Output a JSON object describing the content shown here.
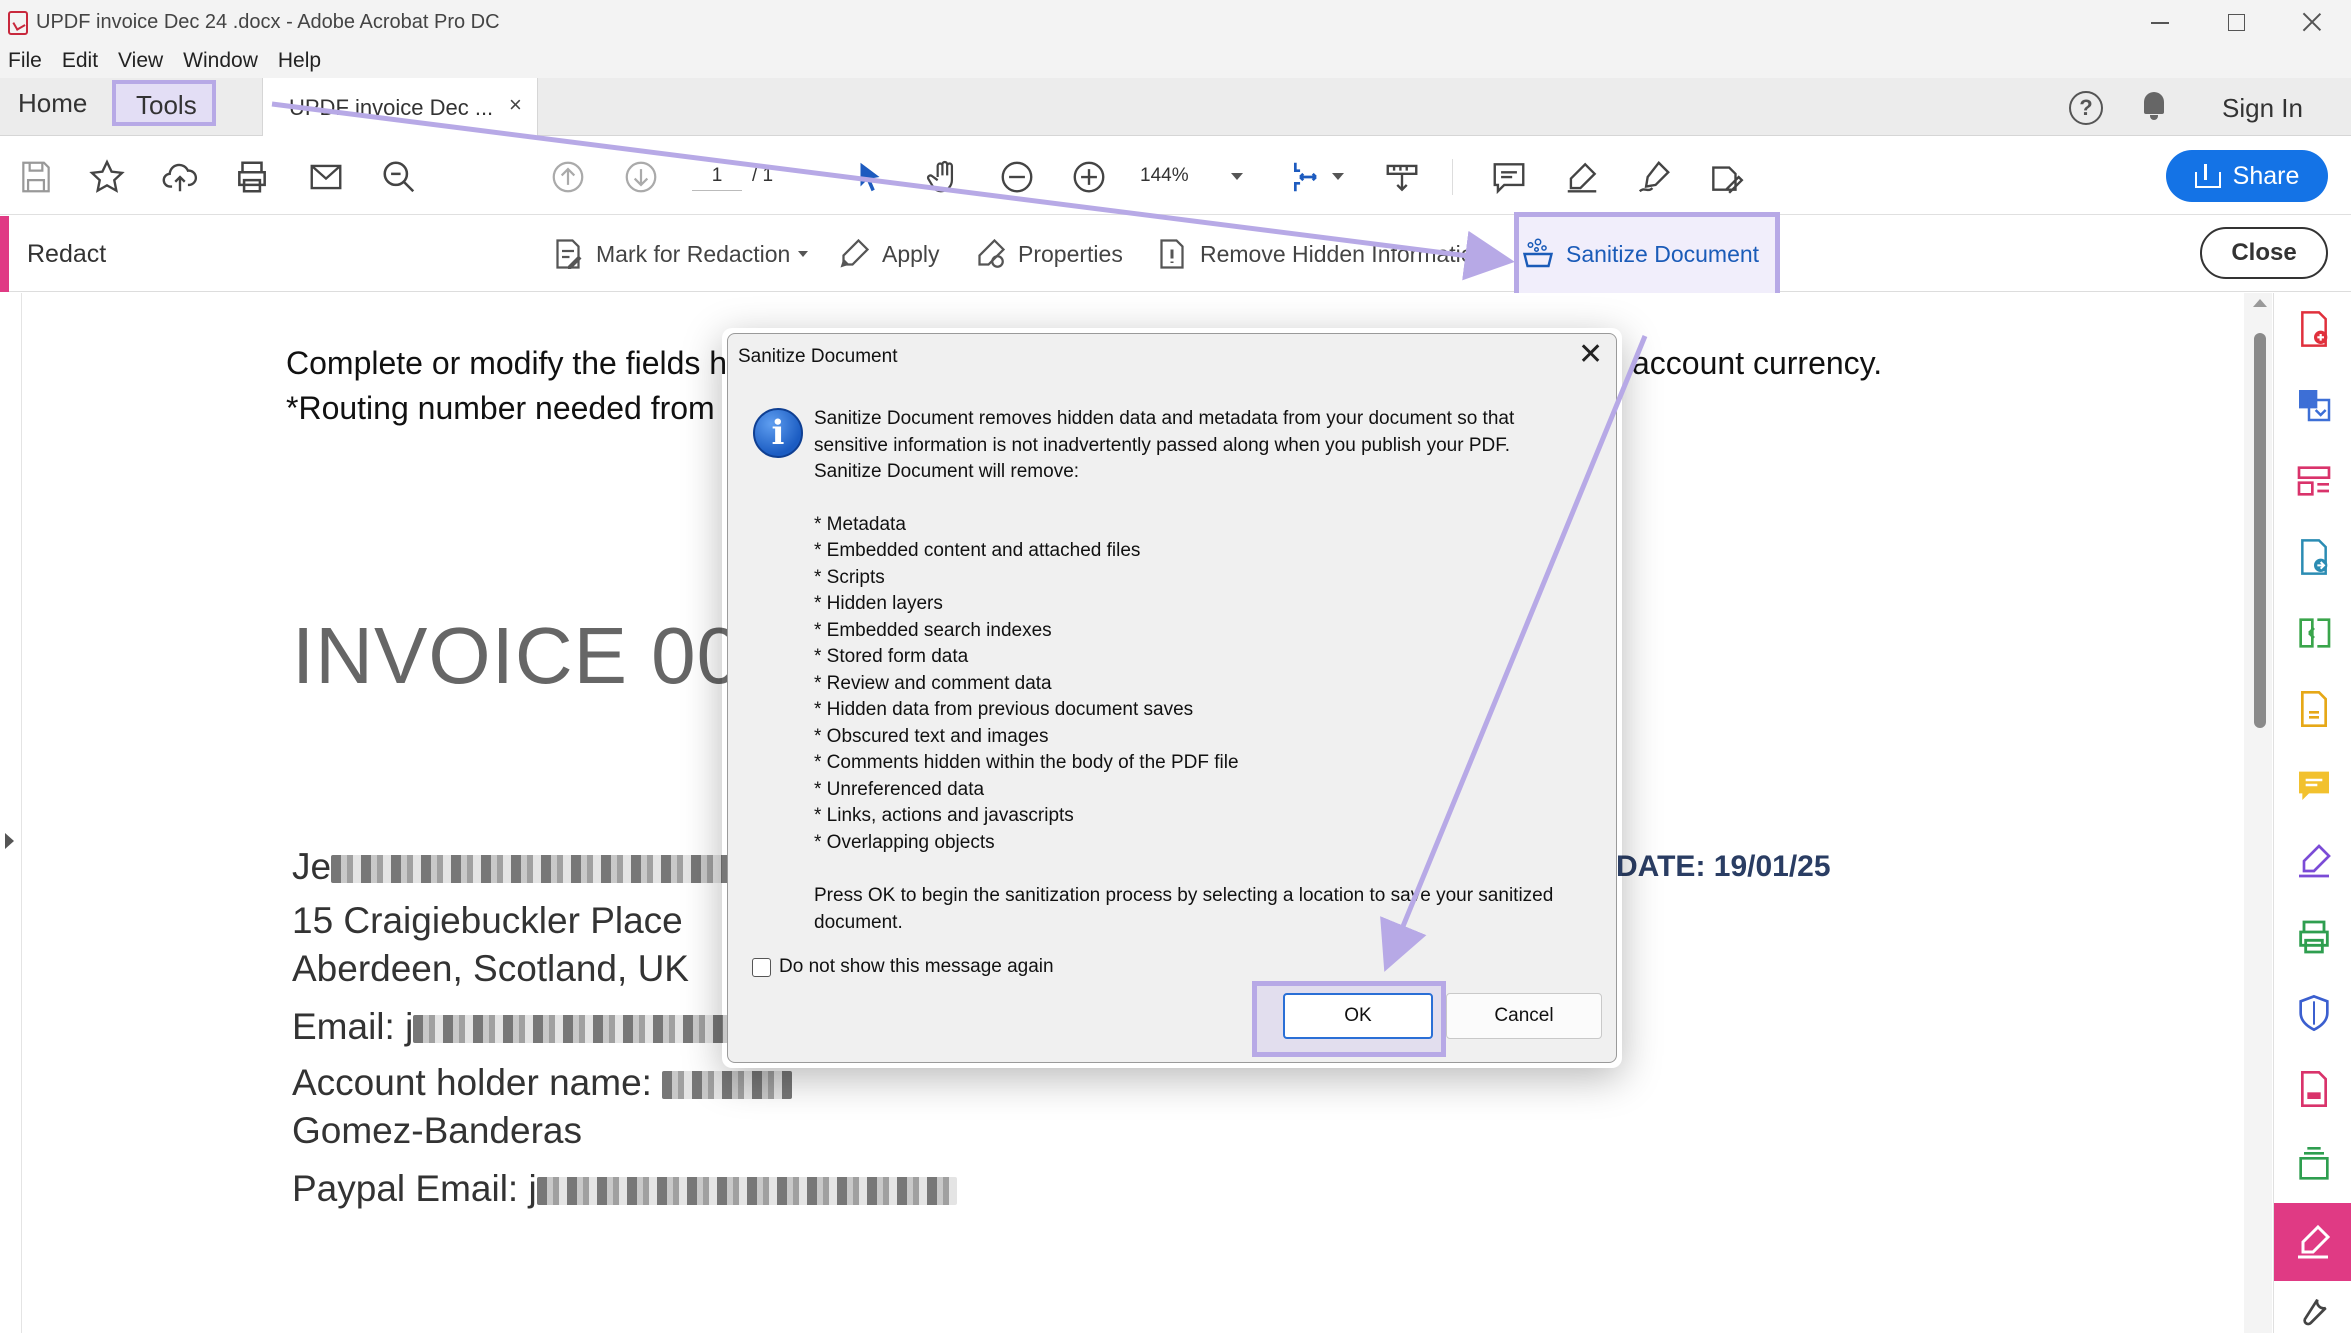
{
  "window": {
    "title": "UPDF invoice Dec 24 .docx - Adobe Acrobat Pro DC"
  },
  "menu": {
    "items": [
      "File",
      "Edit",
      "Window",
      "View",
      "Help"
    ]
  },
  "menu_order": [
    "File",
    "Edit",
    "View",
    "Window",
    "Help"
  ],
  "tabs": {
    "home": "Home",
    "tools": "Tools",
    "document": "UPDF invoice Dec ...",
    "document_close": "×"
  },
  "header_right": {
    "help": "?",
    "sign_in": "Sign In"
  },
  "toolbar": {
    "page_current": "1",
    "page_total": "/ 1",
    "zoom": "144%",
    "share_label": "Share"
  },
  "redact_bar": {
    "title": "Redact",
    "items": {
      "mark": "Mark for Redaction",
      "apply": "Apply",
      "properties": "Properties",
      "remove_hidden": "Remove Hidden Information",
      "sanitize": "Sanitize Document"
    },
    "close_label": "Close"
  },
  "document": {
    "line1_start": "Complete or modify the fields h",
    "line1_end": "account currency.",
    "line2_start": "*Routing number needed from",
    "invoice_title": "INVOICE 000",
    "name_visible": "Je",
    "address_line1": "15 Craigiebuckler Place",
    "address_line2": "Aberdeen, Scotland, UK",
    "email_label": "Email: j",
    "account_holder_label": "Account holder name:",
    "account_holder_rest": "Gomez-Banderas",
    "paypal_label": "Paypal Email: j",
    "date": "DATE: 19/01/25"
  },
  "dialog": {
    "title": "Sanitize Document",
    "close": "✕",
    "intro": "Sanitize Document removes hidden data and metadata from your document so that\nsensitive information is not inadvertently passed along when you publish your PDF.\nSanitize Document will remove:",
    "remove_items": [
      "* Metadata",
      "* Embedded content and attached files",
      "* Scripts",
      "* Hidden layers",
      "* Embedded search indexes",
      "* Stored form data",
      "* Review and comment data",
      "* Hidden data from previous document saves",
      "* Obscured text and images",
      "* Comments hidden within the body of the PDF file",
      "* Unreferenced data",
      "* Links, actions and javascripts",
      "* Overlapping objects"
    ],
    "footer": "Press OK to begin the sanitization process by selecting a location to save your sanitized\ndocument.",
    "checkbox_label": "Do not show this message again",
    "ok_label": "OK",
    "cancel_label": "Cancel"
  },
  "colors": {
    "accent_purple_highlight": "#b7a9e6",
    "share_blue": "#1473e6",
    "redact_pink": "#e03a84",
    "sanitize_text_blue": "#1a5bb8",
    "date_navy": "#2a3d63"
  },
  "icons": {
    "toolbar": [
      "save-icon",
      "star-icon",
      "cloud-upload-icon",
      "print-icon",
      "mail-icon",
      "zoom-search-icon",
      "page-up-icon",
      "page-down-icon",
      "select-arrow-icon",
      "hand-icon",
      "zoom-out-icon",
      "zoom-in-icon",
      "fit-page-icon",
      "scroll-mode-icon",
      "comment-icon",
      "highlighter-icon",
      "sign-pen-icon",
      "edit-stamp-icon"
    ],
    "rail": [
      "create-pdf-icon",
      "export-pdf-icon",
      "organize-pages-icon",
      "combine-files-icon",
      "compress-icon",
      "send-for-review-icon",
      "comment-icon",
      "fill-sign-icon",
      "print-production-icon",
      "protect-icon",
      "edit-pdf-icon",
      "stack-icon",
      "redact-pen-icon",
      "more-tools-icon"
    ]
  }
}
